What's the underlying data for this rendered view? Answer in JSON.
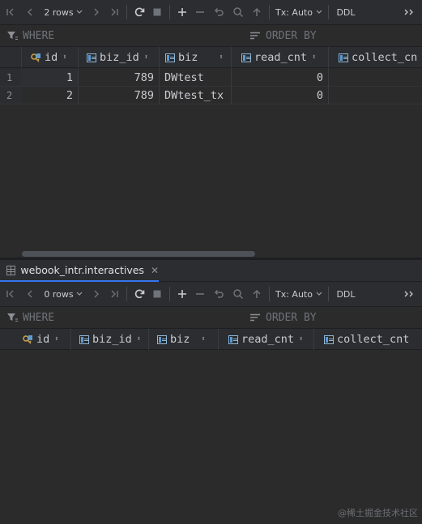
{
  "top": {
    "toolbar": {
      "rows": "2 rows",
      "tx": "Tx: Auto",
      "ddl": "DDL"
    },
    "filter": {
      "where": "WHERE",
      "order_by": "ORDER BY"
    },
    "columns": [
      "id",
      "biz_id",
      "biz",
      "read_cnt",
      "collect_cn"
    ],
    "rows": [
      {
        "num": "1",
        "id": "1",
        "biz_id": "789",
        "biz": "DWtest",
        "read_cnt": "0"
      },
      {
        "num": "2",
        "id": "2",
        "biz_id": "789",
        "biz": "DWtest_tx",
        "read_cnt": "0"
      }
    ]
  },
  "tab": {
    "title": "webook_intr.interactives"
  },
  "bottom": {
    "toolbar": {
      "rows": "0 rows",
      "tx": "Tx: Auto",
      "ddl": "DDL"
    },
    "filter": {
      "where": "WHERE",
      "order_by": "ORDER BY"
    },
    "columns": [
      "id",
      "biz_id",
      "biz",
      "read_cnt",
      "collect_cnt"
    ]
  },
  "watermark": "@稀土掘金技术社区",
  "colors": {
    "background": "#2b2b2b",
    "toolbar": "#2b2d30",
    "accent": "#3574f0"
  }
}
